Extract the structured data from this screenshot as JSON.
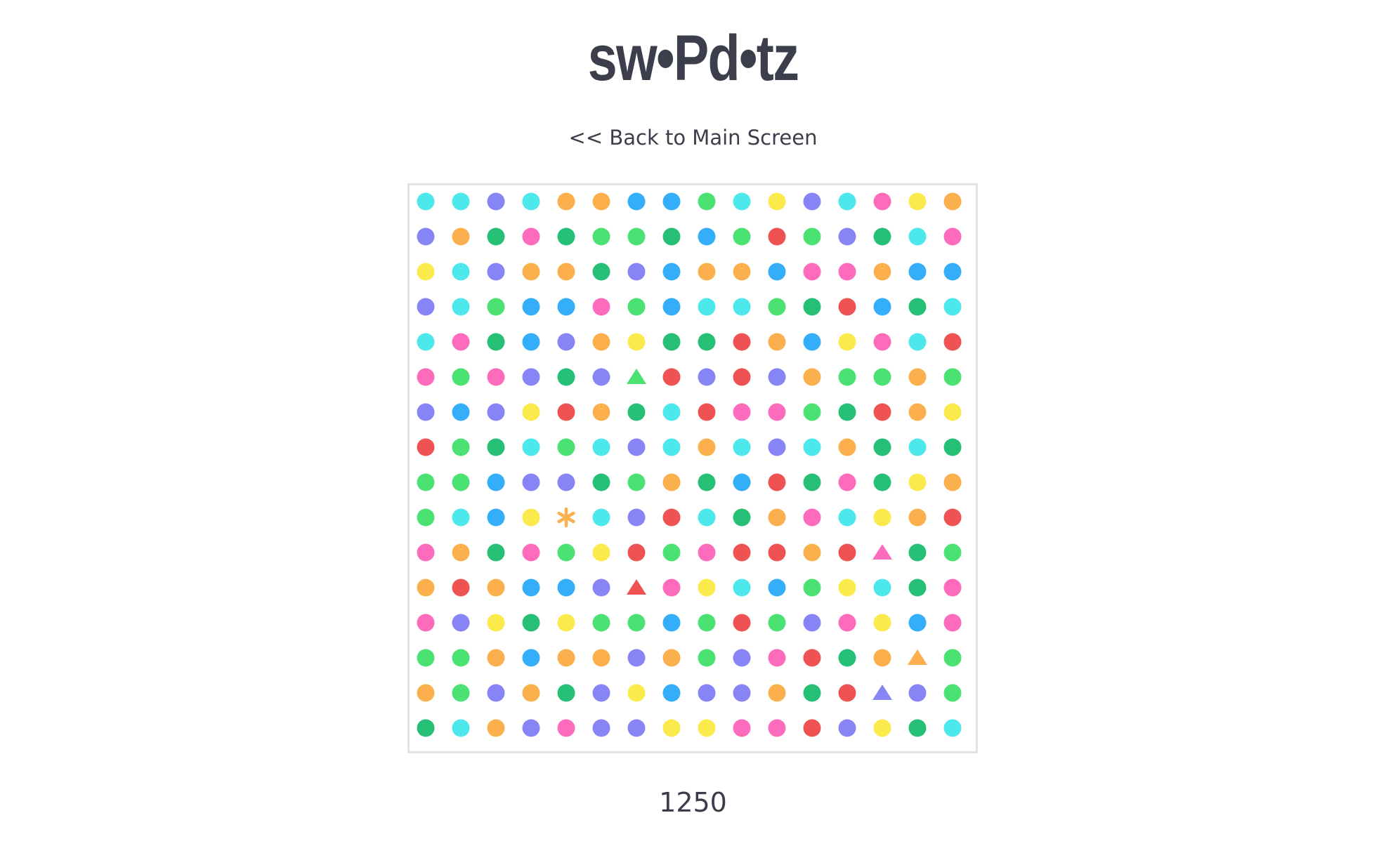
{
  "header": {
    "title": "sw•Pd•tz",
    "back_link": "<< Back to Main Screen"
  },
  "score": "1250",
  "colors": {
    "T": "#4de8ec",
    "P": "#8785f5",
    "O": "#fbb04d",
    "B": "#34aef9",
    "G": "#4ce173",
    "Y": "#faea4c",
    "K": "#fd6bbd",
    "D": "#25bf75",
    "R": "#ef5252"
  },
  "board": {
    "rows": 16,
    "cols": 16,
    "cells": [
      [
        "T",
        "T",
        "P",
        "T",
        "O",
        "O",
        "B",
        "B",
        "G",
        "T",
        "Y",
        "P",
        "T",
        "K",
        "Y",
        "O"
      ],
      [
        "P",
        "O",
        "D",
        "K",
        "D",
        "G",
        "G",
        "D",
        "B",
        "G",
        "R",
        "G",
        "P",
        "D",
        "T",
        "K"
      ],
      [
        "Y",
        "T",
        "P",
        "O",
        "O",
        "D",
        "P",
        "B",
        "O",
        "O",
        "B",
        "K",
        "K",
        "O",
        "B",
        "B"
      ],
      [
        "P",
        "T",
        "G",
        "B",
        "B",
        "K",
        "G",
        "B",
        "T",
        "T",
        "G",
        "D",
        "R",
        "B",
        "D",
        "T"
      ],
      [
        "T",
        "K",
        "D",
        "B",
        "P",
        "O",
        "Y",
        "D",
        "D",
        "R",
        "O",
        "B",
        "Y",
        "K",
        "T",
        "R"
      ],
      [
        "K",
        "G",
        "K",
        "P",
        "D",
        "P",
        "G^",
        "R",
        "P",
        "R",
        "P",
        "O",
        "G",
        "G",
        "O",
        "G"
      ],
      [
        "P",
        "B",
        "P",
        "Y",
        "R",
        "O",
        "D",
        "T",
        "R",
        "K",
        "K",
        "G",
        "D",
        "R",
        "O",
        "Y"
      ],
      [
        "R",
        "G",
        "D",
        "T",
        "G",
        "T",
        "P",
        "T",
        "O",
        "T",
        "P",
        "T",
        "O",
        "D",
        "T",
        "D"
      ],
      [
        "G",
        "G",
        "B",
        "P",
        "P",
        "D",
        "G",
        "O",
        "D",
        "B",
        "R",
        "D",
        "K",
        "D",
        "Y",
        "O"
      ],
      [
        "G",
        "T",
        "B",
        "Y",
        "O*",
        "T",
        "P",
        "R",
        "T",
        "D",
        "O",
        "K",
        "T",
        "Y",
        "O",
        "R"
      ],
      [
        "K",
        "O",
        "D",
        "K",
        "G",
        "Y",
        "R",
        "G",
        "K",
        "R",
        "R",
        "O",
        "R",
        "K^",
        "D",
        "G"
      ],
      [
        "O",
        "R",
        "O",
        "B",
        "B",
        "P",
        "R^",
        "K",
        "Y",
        "T",
        "B",
        "G",
        "Y",
        "T",
        "D",
        "K"
      ],
      [
        "K",
        "P",
        "Y",
        "D",
        "Y",
        "G",
        "G",
        "B",
        "G",
        "R",
        "G",
        "P",
        "K",
        "Y",
        "B",
        "K"
      ],
      [
        "G",
        "G",
        "O",
        "B",
        "O",
        "O",
        "P",
        "O",
        "G",
        "P",
        "K",
        "R",
        "D",
        "O",
        "O^",
        "G"
      ],
      [
        "O",
        "G",
        "P",
        "O",
        "D",
        "P",
        "Y",
        "B",
        "P",
        "P",
        "O",
        "D",
        "R",
        "P^",
        "P",
        "G"
      ],
      [
        "D",
        "T",
        "O",
        "P",
        "K",
        "P",
        "P",
        "Y",
        "Y",
        "K",
        "K",
        "R",
        "P",
        "Y",
        "D",
        "T"
      ]
    ]
  }
}
